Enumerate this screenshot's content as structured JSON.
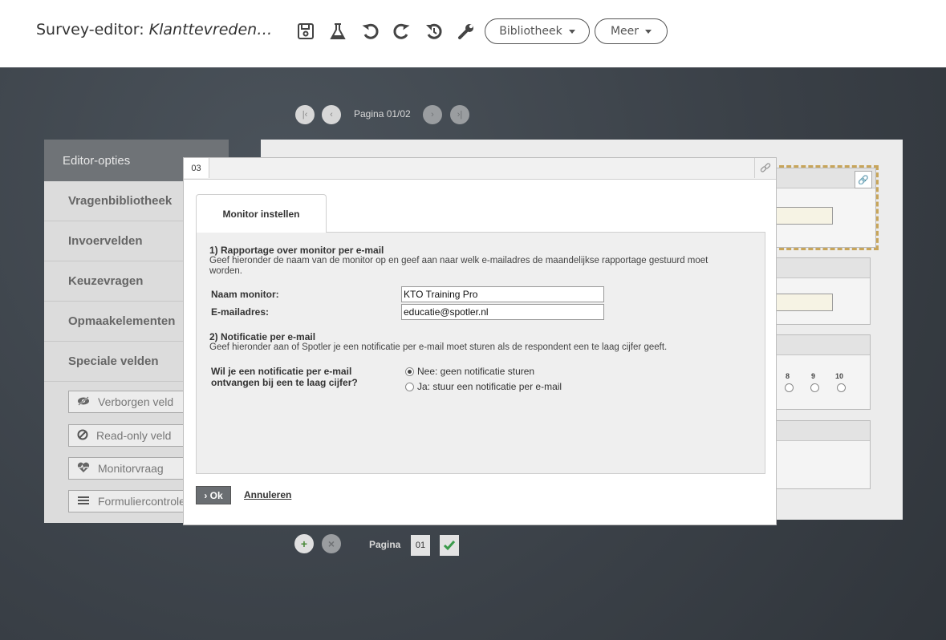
{
  "header": {
    "title_prefix": "Survey-editor: ",
    "title_name": "Klanttevreden…",
    "toolbar_icons": [
      "save-icon",
      "flask-icon",
      "undo-icon",
      "redo-icon",
      "history-icon",
      "wrench-icon"
    ],
    "library_label": "Bibliotheek",
    "more_label": "Meer"
  },
  "pager_top": {
    "label": "Pagina 01/02"
  },
  "sidebar": {
    "title": "Editor-opties",
    "items": [
      {
        "label": "Vragenbibliotheek"
      },
      {
        "label": "Invoervelden"
      },
      {
        "label": "Keuzevragen"
      },
      {
        "label": "Opmaakelementen"
      },
      {
        "label": "Speciale velden"
      }
    ],
    "buttons": [
      {
        "label": "Verborgen veld",
        "icon": "eye-slash-icon"
      },
      {
        "label": "Read-only veld",
        "icon": "ban-icon"
      },
      {
        "label": "Monitorvraag",
        "icon": "heartbeat-icon"
      },
      {
        "label": "Formuliercontrole",
        "icon": "list-icon"
      }
    ]
  },
  "survey_preview": {
    "scale_labels": [
      "8",
      "9",
      "10"
    ]
  },
  "modal": {
    "number": "03",
    "tab_label": "Monitor instellen",
    "section1": {
      "title": "1) Rapportage over monitor per e-mail",
      "desc_line1": "Geef hieronder de naam van de monitor op en geef aan naar welk e-mailadres de maandelijkse rapportage gestuurd moet",
      "desc_line2": "worden."
    },
    "name_label": "Naam monitor:",
    "name_value": "KTO Training Pro",
    "email_label": "E-mailadres:",
    "email_value": "educatie@spotler.nl",
    "section2": {
      "title": "2) Notificatie per e-mail",
      "desc": "Geef hieronder aan of Spotler je een notificatie per e-mail moet sturen als de respondent een te laag cijfer geeft."
    },
    "question_line1": "Wil je een notificatie per e-mail",
    "question_line2": "ontvangen bij een te laag cijfer?",
    "options": [
      {
        "label": "Nee: geen notificatie sturen",
        "selected": true
      },
      {
        "label": "Ja: stuur een notificatie per e-mail",
        "selected": false
      }
    ],
    "ok_label": "› Ok",
    "cancel_label": "Annuleren"
  },
  "pager_bottom": {
    "label": "Pagina",
    "page": "01"
  }
}
